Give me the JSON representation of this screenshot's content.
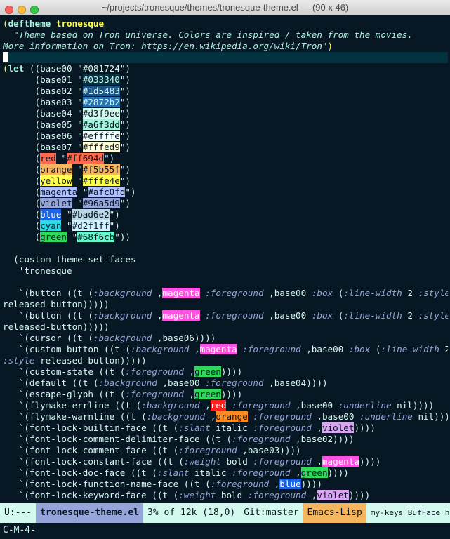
{
  "window": {
    "title": "~/projects/tronesque/themes/tronesque-theme.el  —  (90 x 46)",
    "lights": [
      {
        "name": "close",
        "color": "#fc605b"
      },
      {
        "name": "minimize",
        "color": "#fdbc40"
      },
      {
        "name": "zoom",
        "color": "#34c84a"
      }
    ]
  },
  "theme": {
    "background": "#081724",
    "highlight_line": "#033340",
    "modeline_bg": "#2872b2"
  },
  "styles": {
    "plain": {
      "color": "#d3f9ee"
    },
    "kw": {
      "color": "#a6f3dd",
      "bold": true
    },
    "name": {
      "color": "#fffe4e",
      "bold": true
    },
    "doc": {
      "color": "#a6f3dd",
      "italic": true
    },
    "const": {
      "color": "#96a5d9",
      "italic": true
    },
    "paren": {
      "color": "#fffe4e"
    }
  },
  "editor": {
    "lines": [
      [
        [
          "paren",
          "("
        ],
        [
          "kw",
          "deftheme"
        ],
        [
          "plain",
          " "
        ],
        [
          "name",
          "tronesque"
        ]
      ],
      [
        [
          "doc",
          "  \"Theme based on Tron universe. Colors are inspired / taken from the movies."
        ]
      ],
      [
        [
          "doc",
          "More information on Tron: https://en.wikipedia.org/wiki/Tron\""
        ],
        [
          "paren",
          ")"
        ]
      ],
      {
        "current": true,
        "segs": [
          [
            "cursor",
            ""
          ]
        ]
      },
      [
        [
          "paren",
          "("
        ],
        [
          "kw",
          "let"
        ],
        [
          "plain",
          " (("
        ],
        [
          "plain",
          "base00"
        ],
        [
          "plain",
          " \""
        ],
        [
          "sw:#081724:#d3f9ee",
          "#081724"
        ],
        [
          "plain",
          "\")"
        ]
      ],
      [
        [
          "plain",
          "      ("
        ],
        [
          "plain",
          "base01"
        ],
        [
          "plain",
          " \""
        ],
        [
          "sw:#033340:#d3f9ee",
          "#033340"
        ],
        [
          "plain",
          "\")"
        ]
      ],
      [
        [
          "plain",
          "      ("
        ],
        [
          "plain",
          "base02"
        ],
        [
          "plain",
          " \""
        ],
        [
          "sw:#1d5483:#d3f9ee",
          "#1d5483"
        ],
        [
          "plain",
          "\")"
        ]
      ],
      [
        [
          "plain",
          "      ("
        ],
        [
          "plain",
          "base03"
        ],
        [
          "plain",
          " \""
        ],
        [
          "sw:#2872b2:#d3f9ee",
          "#2872b2"
        ],
        [
          "plain",
          "\")"
        ]
      ],
      [
        [
          "plain",
          "      ("
        ],
        [
          "plain",
          "base04"
        ],
        [
          "plain",
          " \""
        ],
        [
          "sw:#d3f9ee:#081724",
          "#d3f9ee"
        ],
        [
          "plain",
          "\")"
        ]
      ],
      [
        [
          "plain",
          "      ("
        ],
        [
          "plain",
          "base05"
        ],
        [
          "plain",
          " \""
        ],
        [
          "sw:#a6f3dd:#081724",
          "#a6f3dd"
        ],
        [
          "plain",
          "\")"
        ]
      ],
      [
        [
          "plain",
          "      ("
        ],
        [
          "plain",
          "base06"
        ],
        [
          "plain",
          " \""
        ],
        [
          "sw:#effffe:#081724",
          "#effffe"
        ],
        [
          "plain",
          "\")"
        ]
      ],
      [
        [
          "plain",
          "      ("
        ],
        [
          "plain",
          "base07"
        ],
        [
          "plain",
          " \""
        ],
        [
          "sw:#fffed9:#081724",
          "#fffed9"
        ],
        [
          "plain",
          "\")"
        ]
      ],
      [
        [
          "plain",
          "      ("
        ],
        [
          "sw:#ff694d:#081724",
          "red"
        ],
        [
          "plain",
          " \""
        ],
        [
          "sw:#ff694d:#081724",
          "#ff694d"
        ],
        [
          "plain",
          "\")"
        ]
      ],
      [
        [
          "plain",
          "      ("
        ],
        [
          "sw:#f5b55f:#081724",
          "orange"
        ],
        [
          "plain",
          " \""
        ],
        [
          "sw:#f5b55f:#081724",
          "#f5b55f"
        ],
        [
          "plain",
          "\")"
        ]
      ],
      [
        [
          "plain",
          "      ("
        ],
        [
          "sw:#fffe4e:#081724",
          "yellow"
        ],
        [
          "plain",
          " \""
        ],
        [
          "sw:#fffe4e:#081724",
          "#fffe4e"
        ],
        [
          "plain",
          "\")"
        ]
      ],
      [
        [
          "plain",
          "      ("
        ],
        [
          "sw:#afc0fd:#081724",
          "magenta"
        ],
        [
          "plain",
          " \""
        ],
        [
          "sw:#afc0fd:#081724",
          "#afc0fd"
        ],
        [
          "plain",
          "\")"
        ]
      ],
      [
        [
          "plain",
          "      ("
        ],
        [
          "sw:#96a5d9:#081724",
          "violet"
        ],
        [
          "plain",
          " \""
        ],
        [
          "sw:#96a5d9:#081724",
          "#96a5d9"
        ],
        [
          "plain",
          "\")"
        ]
      ],
      [
        [
          "plain",
          "      ("
        ],
        [
          "sw:#1d63e5:#ffffff",
          "blue"
        ],
        [
          "plain",
          " \""
        ],
        [
          "sw:#bad6e2:#081724",
          "#bad6e2"
        ],
        [
          "plain",
          "\")"
        ]
      ],
      [
        [
          "plain",
          "      ("
        ],
        [
          "sw:#2fd7e3:#081724",
          "cyan"
        ],
        [
          "plain",
          " \""
        ],
        [
          "sw:#d2f1ff:#081724",
          "#d2f1ff"
        ],
        [
          "plain",
          "\")"
        ]
      ],
      [
        [
          "plain",
          "      ("
        ],
        [
          "sw:#2fd85a:#081724",
          "green"
        ],
        [
          "plain",
          " \""
        ],
        [
          "sw:#68f6cb:#081724",
          "#68f6cb"
        ],
        [
          "plain",
          "\"))"
        ]
      ],
      [],
      [
        [
          "plain",
          "  (custom-theme-set-faces"
        ]
      ],
      [
        [
          "plain",
          "   'tronesque"
        ]
      ],
      [],
      [
        [
          "plain",
          "   `(button ((t ("
        ],
        [
          "const",
          ":background"
        ],
        [
          "plain",
          " ,"
        ],
        [
          "sw:#ff50e0:#ffffff",
          "magenta"
        ],
        [
          "plain",
          " "
        ],
        [
          "const",
          ":foreground"
        ],
        [
          "plain",
          " ,base00 "
        ],
        [
          "const",
          ":box"
        ],
        [
          "plain",
          " ("
        ],
        [
          "const",
          ":line-width"
        ],
        [
          "plain",
          " 2 "
        ],
        [
          "const",
          ":style"
        ]
      ],
      [
        [
          "plain",
          "released-button)))))"
        ]
      ],
      [
        [
          "plain",
          "   `(button ((t ("
        ],
        [
          "const",
          ":background"
        ],
        [
          "plain",
          " ,"
        ],
        [
          "sw:#ff50e0:#ffffff",
          "magenta"
        ],
        [
          "plain",
          " "
        ],
        [
          "const",
          ":foreground"
        ],
        [
          "plain",
          " ,base00 "
        ],
        [
          "const",
          ":box"
        ],
        [
          "plain",
          " ("
        ],
        [
          "const",
          ":line-width"
        ],
        [
          "plain",
          " 2 "
        ],
        [
          "const",
          ":style"
        ]
      ],
      [
        [
          "plain",
          "released-button)))))"
        ]
      ],
      [
        [
          "plain",
          "   `(cursor ((t ("
        ],
        [
          "const",
          ":background"
        ],
        [
          "plain",
          " ,base06))))"
        ]
      ],
      [
        [
          "plain",
          "   `(custom-button ((t ("
        ],
        [
          "const",
          ":background"
        ],
        [
          "plain",
          " ,"
        ],
        [
          "sw:#ff50e0:#ffffff",
          "magenta"
        ],
        [
          "plain",
          " "
        ],
        [
          "const",
          ":foreground"
        ],
        [
          "plain",
          " ,base00 "
        ],
        [
          "const",
          ":box"
        ],
        [
          "plain",
          " ("
        ],
        [
          "const",
          ":line-width"
        ],
        [
          "plain",
          " 2"
        ]
      ],
      [
        [
          "const",
          ":style"
        ],
        [
          "plain",
          " released-button)))))"
        ]
      ],
      [
        [
          "plain",
          "   `(custom-state ((t ("
        ],
        [
          "const",
          ":foreground"
        ],
        [
          "plain",
          " ,"
        ],
        [
          "sw:#2fd85a:#081724",
          "green"
        ],
        [
          "plain",
          "))))"
        ]
      ],
      [
        [
          "plain",
          "   `(default ((t ("
        ],
        [
          "const",
          ":background"
        ],
        [
          "plain",
          " ,base00 "
        ],
        [
          "const",
          ":foreground"
        ],
        [
          "plain",
          " ,base04))))"
        ]
      ],
      [
        [
          "plain",
          "   `(escape-glyph ((t ("
        ],
        [
          "const",
          ":foreground"
        ],
        [
          "plain",
          " ,"
        ],
        [
          "sw:#2fd85a:#081724",
          "green"
        ],
        [
          "plain",
          "))))"
        ]
      ],
      [
        [
          "plain",
          "   `(flymake-errline ((t ("
        ],
        [
          "const",
          ":background"
        ],
        [
          "plain",
          " ,"
        ],
        [
          "sw:#ff1f1f:#ffffff",
          "red"
        ],
        [
          "plain",
          " "
        ],
        [
          "const",
          ":foreground"
        ],
        [
          "plain",
          " ,base00 "
        ],
        [
          "const",
          ":underline"
        ],
        [
          "plain",
          " nil))))"
        ]
      ],
      [
        [
          "plain",
          "   `(flymake-warnline ((t ("
        ],
        [
          "const",
          ":background"
        ],
        [
          "plain",
          " ,"
        ],
        [
          "sw:#ff8a1f:#081724",
          "orange"
        ],
        [
          "plain",
          " "
        ],
        [
          "const",
          ":foreground"
        ],
        [
          "plain",
          " ,base00 "
        ],
        [
          "const",
          ":underline"
        ],
        [
          "plain",
          " nil))))"
        ]
      ],
      [
        [
          "plain",
          "   `(font-lock-builtin-face ((t ("
        ],
        [
          "const",
          ":slant"
        ],
        [
          "plain",
          " italic "
        ],
        [
          "const",
          ":foreground"
        ],
        [
          "plain",
          " ,"
        ],
        [
          "sw:#d8a6f0:#081724",
          "violet"
        ],
        [
          "plain",
          "))))"
        ]
      ],
      [
        [
          "plain",
          "   `(font-lock-comment-delimiter-face ((t ("
        ],
        [
          "const",
          ":foreground"
        ],
        [
          "plain",
          " ,base02))))"
        ]
      ],
      [
        [
          "plain",
          "   `(font-lock-comment-face ((t ("
        ],
        [
          "const",
          ":foreground"
        ],
        [
          "plain",
          " ,base03))))"
        ]
      ],
      [
        [
          "plain",
          "   `(font-lock-constant-face ((t ("
        ],
        [
          "const",
          ":weight"
        ],
        [
          "plain",
          " bold "
        ],
        [
          "const",
          ":foreground"
        ],
        [
          "plain",
          " ,"
        ],
        [
          "sw:#ff50e0:#ffffff",
          "magenta"
        ],
        [
          "plain",
          "))))"
        ]
      ],
      [
        [
          "plain",
          "   `(font-lock-doc-face ((t ("
        ],
        [
          "const",
          ":slant"
        ],
        [
          "plain",
          " italic "
        ],
        [
          "const",
          ":foreground"
        ],
        [
          "plain",
          " ,"
        ],
        [
          "sw:#2fd85a:#081724",
          "green"
        ],
        [
          "plain",
          "))))"
        ]
      ],
      [
        [
          "plain",
          "   `(font-lock-function-name-face ((t ("
        ],
        [
          "const",
          ":foreground"
        ],
        [
          "plain",
          " ,"
        ],
        [
          "sw:#1d63e5:#ffffff",
          "blue"
        ],
        [
          "plain",
          "))))"
        ]
      ],
      [
        [
          "plain",
          "   `(font-lock-keyword-face ((t ("
        ],
        [
          "const",
          ":weight"
        ],
        [
          "plain",
          " bold "
        ],
        [
          "const",
          ":foreground"
        ],
        [
          "plain",
          " ,"
        ],
        [
          "sw:#d8a6f0:#081724",
          "violet"
        ],
        [
          "plain",
          "))))"
        ]
      ]
    ]
  },
  "modeline": {
    "status": "U:---",
    "buffer": "tronesque-theme.el",
    "position": "3% of 12k  (18,0)",
    "vc": "Git:master",
    "major_mode": "Emacs-Lisp",
    "minor_modes": "my-keys BufFace hs"
  },
  "minibuffer": {
    "text": "C-M-4-"
  }
}
